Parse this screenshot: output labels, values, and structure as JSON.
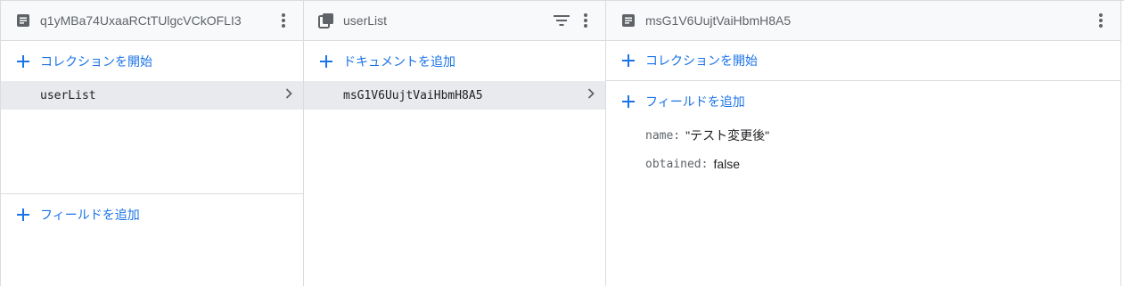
{
  "panel1": {
    "header_title": "q1yMBa74UxaaRCtTUlgcVCkOFLI3",
    "add_collection_label": "コレクションを開始",
    "items": [
      {
        "label": "userList"
      }
    ],
    "add_field_label": "フィールドを追加"
  },
  "panel2": {
    "header_title": "userList",
    "add_document_label": "ドキュメントを追加",
    "items": [
      {
        "label": "msG1V6UujtVaiHbmH8A5"
      }
    ]
  },
  "panel3": {
    "header_title": "msG1V6UujtVaiHbmH8A5",
    "add_collection_label": "コレクションを開始",
    "add_field_label": "フィールドを追加",
    "fields": [
      {
        "key": "name:",
        "value": "\"テスト変更後\""
      },
      {
        "key": "obtained:",
        "value": "false"
      }
    ]
  },
  "colors": {
    "accent": "#1a73e8",
    "selected_bg": "#e8eaed",
    "header_bg": "#f8f9fa",
    "border": "#dadce0"
  },
  "icons": [
    "document-icon",
    "collection-icon",
    "more-vert-icon",
    "filter-icon",
    "add-icon",
    "chevron-right-icon"
  ]
}
